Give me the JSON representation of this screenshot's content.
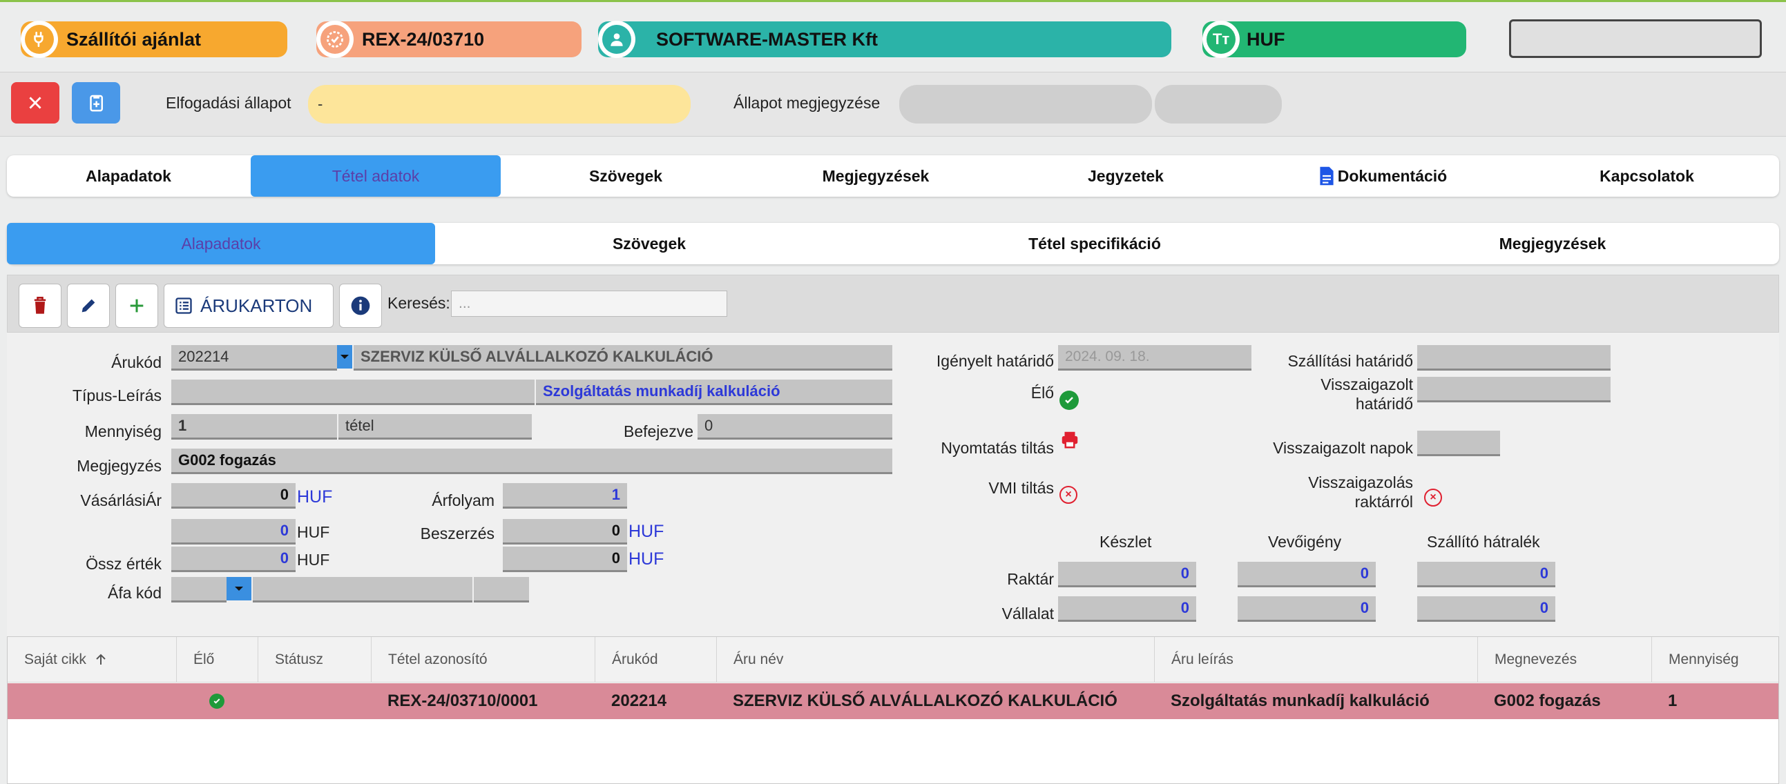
{
  "header": {
    "doc_type": "Szállítói ajánlat",
    "doc_number": "REX-24/03710",
    "partner": "SOFTWARE-MASTER Kft",
    "currency": "HUF",
    "colors": {
      "doc_type": "#f7a82f",
      "doc_number": "#f6a27c",
      "partner": "#2bb3a8",
      "currency": "#22b673"
    }
  },
  "status": {
    "acceptance_label": "Elfogadási állapot",
    "acceptance_value": "-",
    "note_label": "Állapot megjegyzése"
  },
  "main_tabs": [
    {
      "label": "Alapadatok"
    },
    {
      "label": "Tétel adatok"
    },
    {
      "label": "Szövegek"
    },
    {
      "label": "Megjegyzések"
    },
    {
      "label": "Jegyzetek"
    },
    {
      "label": "Dokumentáció"
    },
    {
      "label": "Kapcsolatok"
    }
  ],
  "sub_tabs": [
    {
      "label": "Alapadatok"
    },
    {
      "label": "Szövegek"
    },
    {
      "label": "Tétel specifikáció"
    },
    {
      "label": "Megjegyzések"
    }
  ],
  "toolbar": {
    "arukarton_label": "ÁRUKARTON",
    "search_label": "Keresés:",
    "search_placeholder": "..."
  },
  "form": {
    "arukod_label": "Árukód",
    "arukod_value": "202214",
    "arukod_name": "SZERVIZ KÜLSŐ ALVÁLLALKOZÓ KALKULÁCIÓ",
    "tipus_label": "Típus-Leírás",
    "tipus_value": "Szolgáltatás munkadíj kalkuláció",
    "mennyiseg_label": "Mennyiség",
    "mennyiseg_value": "1",
    "mennyiseg_unit": "tétel",
    "befejezve_label": "Befejezve",
    "befejezve_value": "0",
    "megjegyzes_label": "Megjegyzés",
    "megjegyzes_value": "G002 fogazás",
    "vasarlasi_label": "VásárlásiÁr",
    "vasarlasi_value": "0",
    "vasarlasi_cur": "HUF",
    "arfolyam_label": "Árfolyam",
    "arfolyam_value": "1",
    "row2_value": "0",
    "row2_cur": "HUF",
    "beszerzes_label": "Beszerzés",
    "beszerzes_value": "0",
    "beszerzes_cur": "HUF",
    "ossz_label": "Össz érték",
    "ossz_value": "0",
    "ossz_cur": "HUF",
    "ossz_right_value": "0",
    "ossz_right_cur": "HUF",
    "afa_label": "Áfa kód",
    "igenyelt_label": "Igényelt határidő",
    "igenyelt_value": "2024. 09. 18.",
    "elo_label": "Élő",
    "nyomtatas_label": "Nyomtatás tiltás",
    "vmi_label": "VMI tiltás",
    "szallitasi_label": "Szállítási határidő",
    "visszaig_hat_label_1": "Visszaigazolt",
    "visszaig_hat_label_2": "határidő",
    "visszaig_napok_label": "Visszaigazolt napok",
    "visszaig_raktar_label_1": "Visszaigazolás",
    "visszaig_raktar_label_2": "raktárról",
    "stock_headers": [
      "Készlet",
      "Vevőigény",
      "Szállító hátralék"
    ],
    "raktar_label": "Raktár",
    "vallalat_label": "Vállalat",
    "raktar_values": [
      "0",
      "0",
      "0"
    ],
    "vallalat_values": [
      "0",
      "0",
      "0"
    ]
  },
  "grid": {
    "columns": [
      "Saját cikk",
      "Élő",
      "Státusz",
      "Tétel azonosító",
      "Árukód",
      "Áru név",
      "Áru leírás",
      "Megnevezés",
      "Mennyiség"
    ],
    "rows": [
      {
        "tetel": "REX-24/03710/0001",
        "arukod": "202214",
        "nev": "SZERVIZ KÜLSŐ ALVÁLLALKOZÓ KALKULÁCIÓ",
        "leiras": "Szolgáltatás munkadíj kalkuláció",
        "megnevezes": "G002 fogazás",
        "mennyiseg": "1"
      }
    ]
  }
}
